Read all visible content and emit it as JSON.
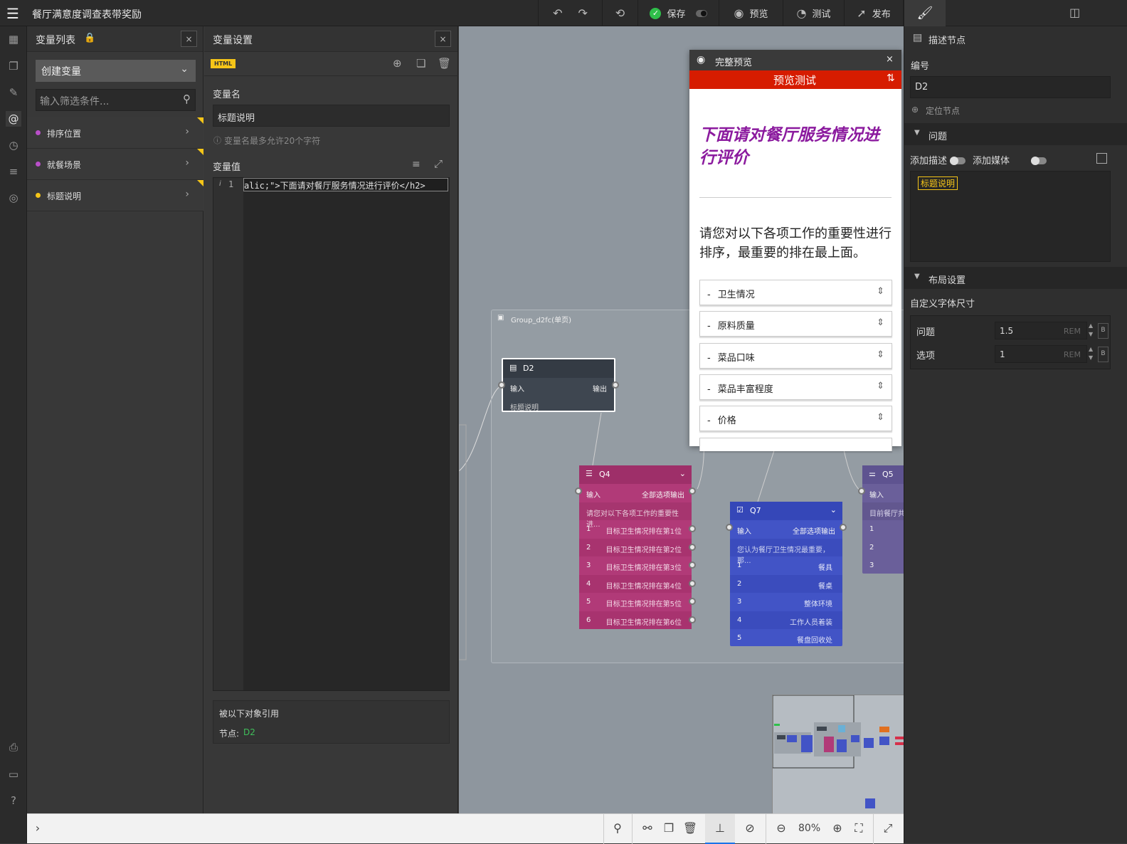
{
  "app": {
    "title": "餐厅满意度调查表带奖励"
  },
  "toolbar": {
    "save_label": "保存",
    "preview_label": "预览",
    "test_label": "测试",
    "publish_label": "发布"
  },
  "var_list": {
    "title": "变量列表",
    "create_label": "创建变量",
    "filter_placeholder": "输入筛选条件...",
    "items": [
      {
        "label": "排序位置",
        "dot_color": "#b94fc9"
      },
      {
        "label": "就餐场景",
        "dot_color": "#b94fc9"
      },
      {
        "label": "标题说明",
        "dot_color": "#f5c518"
      }
    ]
  },
  "var_settings": {
    "title": "变量设置",
    "type_badge": "HTML",
    "name_label": "变量名",
    "name_value": "标题说明",
    "name_hint": "变量名最多允许20个字符",
    "value_label": "变量值",
    "code_line_number": "1",
    "code_text": "alic;\">下面请对餐厅服务情况进行评价</h2>",
    "ref_title": "被以下对象引用",
    "ref_node_label": "节点:",
    "ref_node_value": "D2"
  },
  "canvas": {
    "group_label": "Group_d2fc(单页)",
    "d2": {
      "title": "D2",
      "in": "输入",
      "out": "输出",
      "body": "标题说明"
    },
    "q4": {
      "title": "Q4",
      "in": "输入",
      "out": "全部选项输出",
      "desc": "请您对以下各项工作的重要性进...",
      "rows": [
        {
          "n": "1",
          "t": "目标卫生情况排在第1位"
        },
        {
          "n": "2",
          "t": "目标卫生情况排在第2位"
        },
        {
          "n": "3",
          "t": "目标卫生情况排在第3位"
        },
        {
          "n": "4",
          "t": "目标卫生情况排在第4位"
        },
        {
          "n": "5",
          "t": "目标卫生情况排在第5位"
        },
        {
          "n": "6",
          "t": "目标卫生情况排在第6位"
        }
      ]
    },
    "q7": {
      "title": "Q7",
      "in": "输入",
      "out": "全部选项输出",
      "desc": "您认为餐厅卫生情况最重要，那...",
      "rows": [
        {
          "n": "1",
          "t": "餐具"
        },
        {
          "n": "2",
          "t": "餐桌"
        },
        {
          "n": "3",
          "t": "整体环境"
        },
        {
          "n": "4",
          "t": "工作人员着装"
        },
        {
          "n": "5",
          "t": "餐盘回收处"
        }
      ]
    },
    "q5": {
      "title": "Q5",
      "in": "输入",
      "desc": "目前餐厅共",
      "rows": [
        "1",
        "2",
        "3"
      ]
    }
  },
  "preview": {
    "title": "完整预览",
    "bar_title": "预览测试",
    "heading": "下面请对餐厅服务情况进行评价",
    "question": "请您对以下各项工作的重要性进行排序，最重要的排在最上面。",
    "items": [
      "卫生情况",
      "原料质量",
      "菜品口味",
      "菜品丰富程度",
      "价格"
    ],
    "item_prefix": "-"
  },
  "right_panel": {
    "describe_label": "描述节点",
    "id_label": "编号",
    "id_value": "D2",
    "locate_label": "定位节点",
    "question_section": "问题",
    "add_desc": "添加描述",
    "add_media": "添加媒体",
    "tag_text": "标题说明",
    "layout_section": "布局设置",
    "font_size_label": "自定义字体尺寸",
    "q_label": "问题",
    "q_value": "1.5",
    "opt_label": "选项",
    "opt_value": "1",
    "unit": "REM",
    "bold": "B"
  },
  "bottom_bar": {
    "zoom": "80%"
  },
  "colors": {
    "q4": "#b13a78",
    "q7": "#4254c6",
    "q5": "#6a5f9a",
    "d2": "#3e4650",
    "preview_red": "#d61c00",
    "heading_purple": "#8b1a9e"
  }
}
